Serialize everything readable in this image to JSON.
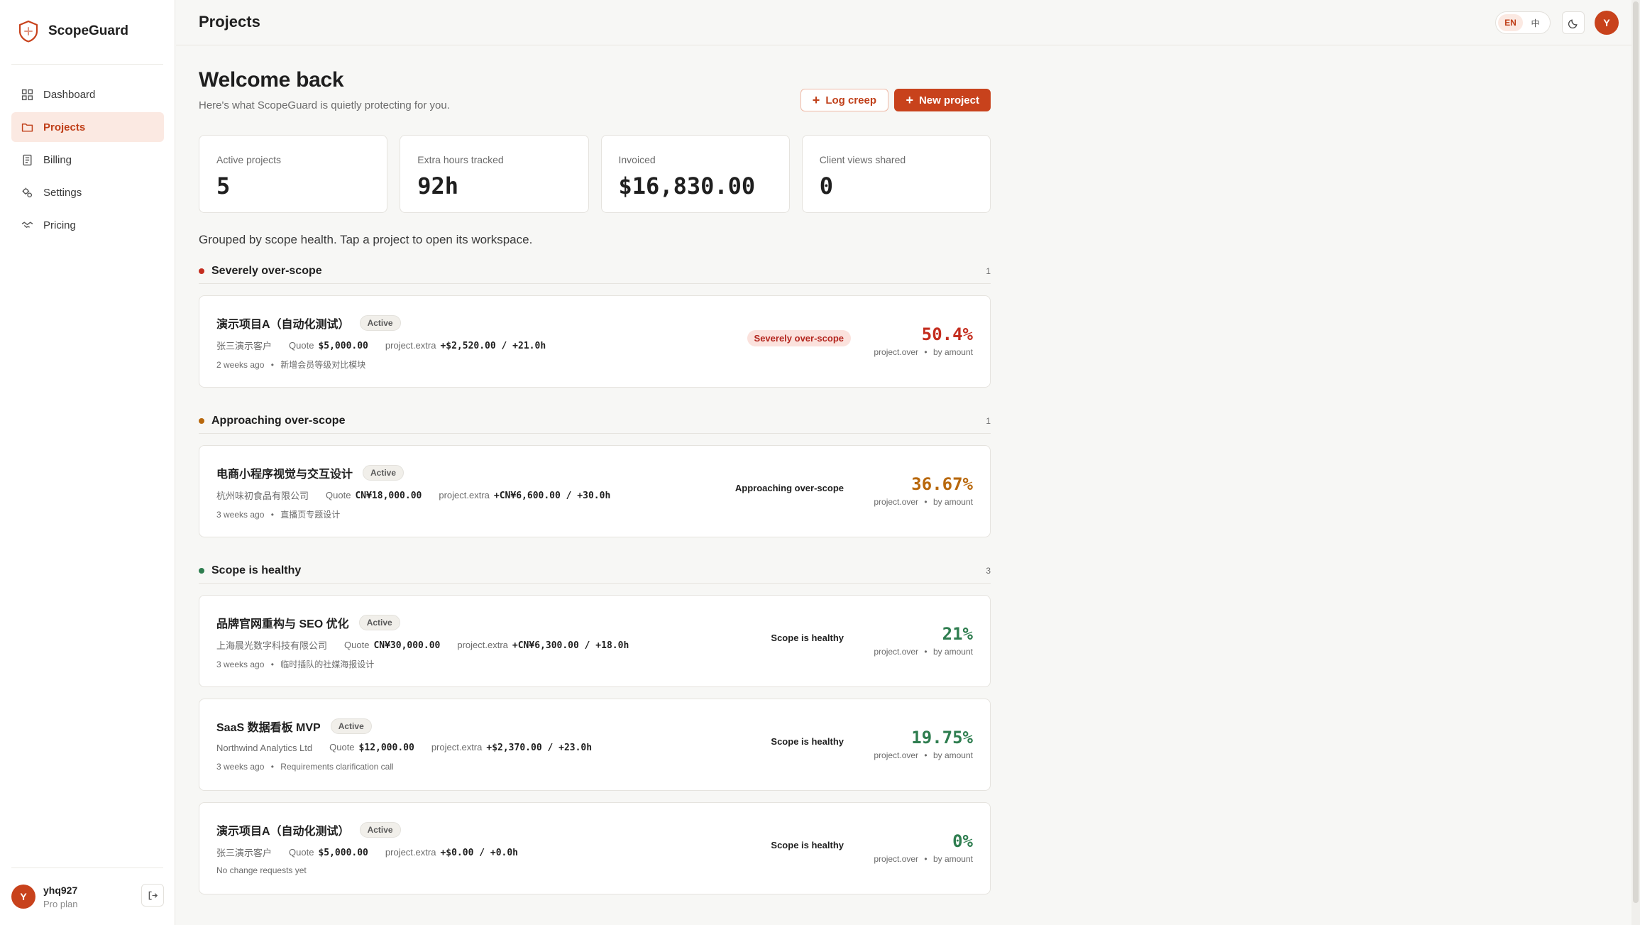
{
  "app": {
    "name": "ScopeGuard"
  },
  "sidebar": {
    "items": [
      {
        "label": "Dashboard",
        "icon": "grid-icon",
        "active": false
      },
      {
        "label": "Projects",
        "icon": "folder-icon",
        "active": true
      },
      {
        "label": "Billing",
        "icon": "receipt-icon",
        "active": false
      },
      {
        "label": "Settings",
        "icon": "gears-icon",
        "active": false
      },
      {
        "label": "Pricing",
        "icon": "handshake-icon",
        "active": false
      }
    ],
    "user": {
      "initial": "Y",
      "name": "yhq927",
      "plan": "Pro plan"
    }
  },
  "topbar": {
    "title": "Projects",
    "lang": {
      "en": "EN",
      "zh": "中"
    },
    "avatar_initial": "Y"
  },
  "main": {
    "welcome": "Welcome back",
    "subtitle": "Here's what ScopeGuard is quietly protecting for you.",
    "log_creep_label": "Log creep",
    "new_project_label": "New project",
    "grouped_note": "Grouped by scope health. Tap a project to open its workspace."
  },
  "stats": [
    {
      "label": "Active projects",
      "value": "5"
    },
    {
      "label": "Extra hours tracked",
      "value": "92h"
    },
    {
      "label": "Invoiced",
      "value": "$16,830.00"
    },
    {
      "label": "Client views shared",
      "value": "0"
    }
  ],
  "groups": [
    {
      "title": "Severely over-scope",
      "count": "1",
      "color": "#c42d1f",
      "projects": [
        {
          "name": "演示项目A（自动化测试）",
          "badge": "Active",
          "client": "张三演示客户",
          "quote_label": "Quote",
          "quote": "$5,000.00",
          "extra_label": "project.extra",
          "extra": "+$2,520.00 / +21.0h",
          "when": "2 weeks ago",
          "sep": "•",
          "note": "新增会员等级对比模块",
          "status": "Severely over-scope",
          "percent": "50.4%",
          "pct_label": "project.over",
          "pct_by": "by amount"
        }
      ]
    },
    {
      "title": "Approaching over-scope",
      "count": "1",
      "color": "#b8680d",
      "projects": [
        {
          "name": "电商小程序视觉与交互设计",
          "badge": "Active",
          "client": "杭州味初食品有限公司",
          "quote_label": "Quote",
          "quote": "CN¥18,000.00",
          "extra_label": "project.extra",
          "extra": "+CN¥6,600.00 / +30.0h",
          "when": "3 weeks ago",
          "sep": "•",
          "note": "直播页专题设计",
          "status": "Approaching over-scope",
          "percent": "36.67%",
          "pct_label": "project.over",
          "pct_by": "by amount"
        }
      ]
    },
    {
      "title": "Scope is healthy",
      "count": "3",
      "color": "#2e7d4f",
      "projects": [
        {
          "name": "品牌官网重构与 SEO 优化",
          "badge": "Active",
          "client": "上海晨光数字科技有限公司",
          "quote_label": "Quote",
          "quote": "CN¥30,000.00",
          "extra_label": "project.extra",
          "extra": "+CN¥6,300.00 / +18.0h",
          "when": "3 weeks ago",
          "sep": "•",
          "note": "临时插队的社媒海报设计",
          "status": "Scope is healthy",
          "percent": "21%",
          "pct_label": "project.over",
          "pct_by": "by amount"
        },
        {
          "name": "SaaS 数据看板 MVP",
          "badge": "Active",
          "client": "Northwind Analytics Ltd",
          "quote_label": "Quote",
          "quote": "$12,000.00",
          "extra_label": "project.extra",
          "extra": "+$2,370.00 / +23.0h",
          "when": "3 weeks ago",
          "sep": "•",
          "note": "Requirements clarification call",
          "status": "Scope is healthy",
          "percent": "19.75%",
          "pct_label": "project.over",
          "pct_by": "by amount"
        },
        {
          "name": "演示项目A（自动化测试）",
          "badge": "Active",
          "client": "张三演示客户",
          "quote_label": "Quote",
          "quote": "$5,000.00",
          "extra_label": "project.extra",
          "extra": "+$0.00 / +0.0h",
          "when": "",
          "sep": "",
          "note": "No change requests yet",
          "status": "Scope is healthy",
          "percent": "0%",
          "pct_label": "project.over",
          "pct_by": "by amount"
        }
      ]
    }
  ],
  "colors": {
    "accent": "#c8421c",
    "severe": "#c42d1f",
    "approaching": "#b8680d",
    "healthy": "#2e7d4f"
  }
}
